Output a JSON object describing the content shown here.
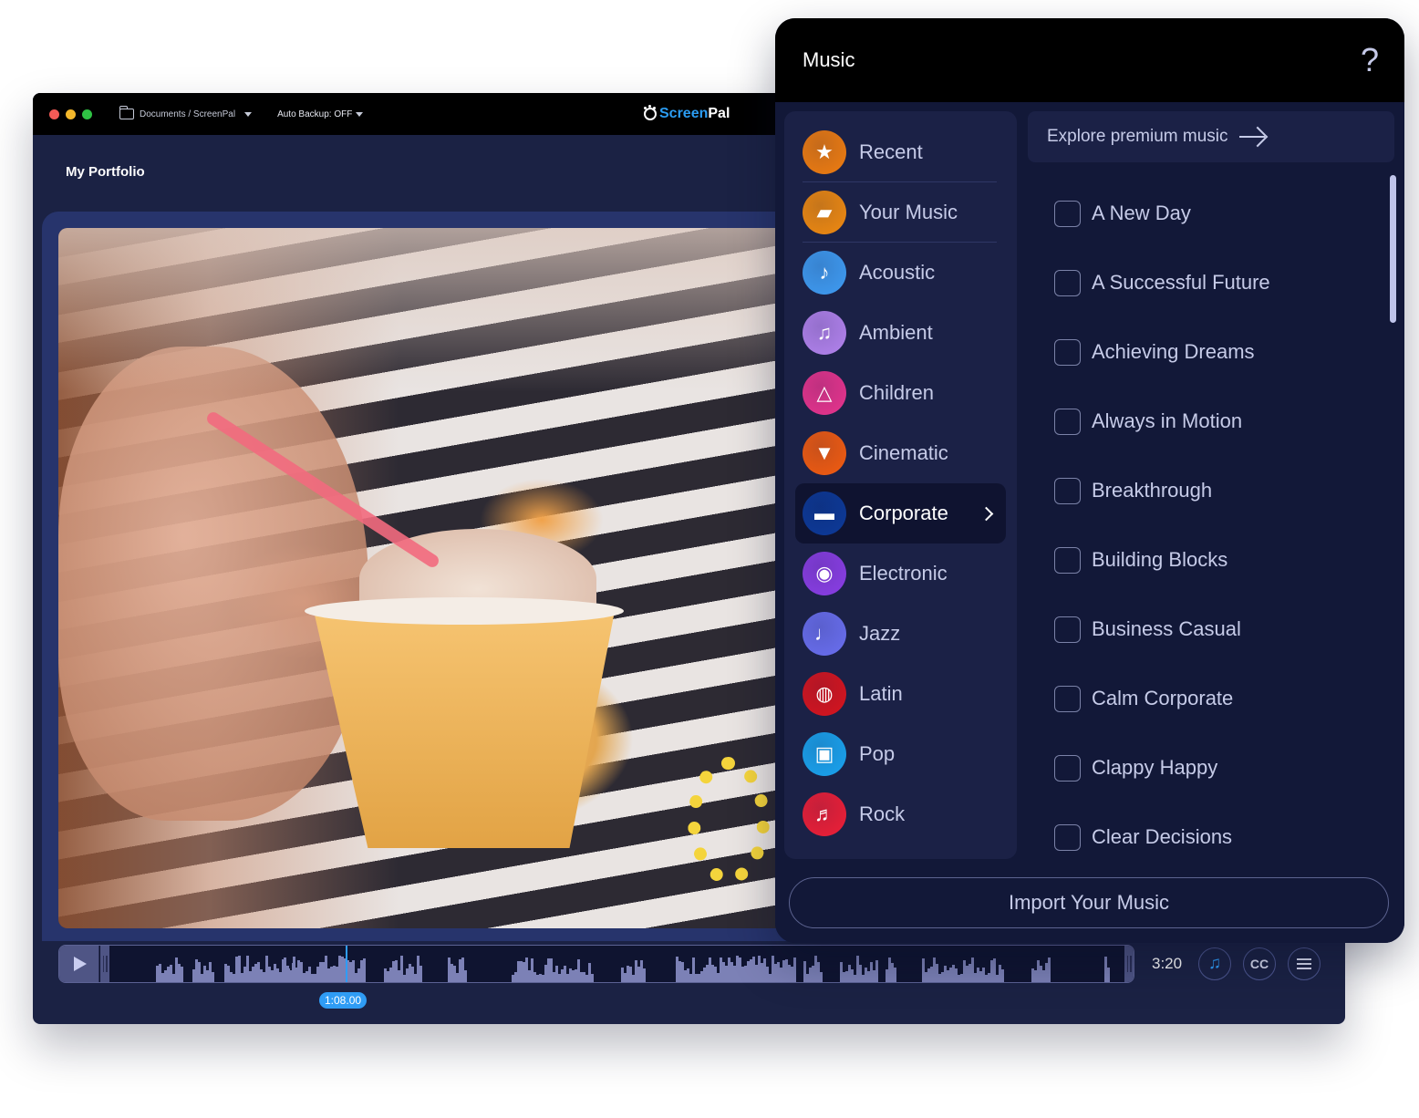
{
  "editor": {
    "breadcrumb": "Documents / ScreenPal",
    "auto_backup": "Auto Backup: OFF",
    "brand_part1": "Screen",
    "brand_part2": "Pal",
    "section_title": "My Portfolio",
    "timeline": {
      "playhead_time": "1:08.00",
      "playhead_fraction": 0.266,
      "duration": "3:20",
      "cc_label": "CC"
    }
  },
  "music_panel": {
    "title": "Music",
    "help_label": "?",
    "explore_label": "Explore premium music",
    "categories": [
      {
        "label": "Recent",
        "icon": "sparkle-star-icon",
        "color": "#f07d10",
        "glyph": "★"
      },
      {
        "label": "Your Music",
        "icon": "folder-bookmark-icon",
        "color": "#f08a10",
        "glyph": "▰"
      },
      {
        "label": "Acoustic",
        "icon": "acoustic-guitar-icon",
        "color": "#3f9cf3",
        "glyph": "♪"
      },
      {
        "label": "Ambient",
        "icon": "electric-guitar-icon",
        "color": "#b383ee",
        "glyph": "♫"
      },
      {
        "label": "Children",
        "icon": "metronome-icon",
        "color": "#e8348e",
        "glyph": "△"
      },
      {
        "label": "Cinematic",
        "icon": "popcorn-icon",
        "color": "#f35c10",
        "glyph": "▼"
      },
      {
        "label": "Corporate",
        "icon": "briefcase-icon",
        "color": "#0d3a9a",
        "glyph": "▬",
        "active": true
      },
      {
        "label": "Electronic",
        "icon": "turntable-icon",
        "color": "#8b3ee6",
        "glyph": "◉"
      },
      {
        "label": "Jazz",
        "icon": "saxophone-icon",
        "color": "#6a6ff0",
        "glyph": "♩"
      },
      {
        "label": "Latin",
        "icon": "drum-icon",
        "color": "#d8141e",
        "glyph": "◍"
      },
      {
        "label": "Pop",
        "icon": "radio-icon",
        "color": "#1aa4f0",
        "glyph": "▣"
      },
      {
        "label": "Rock",
        "icon": "rock-guitar-icon",
        "color": "#ef1f37",
        "glyph": "♬"
      }
    ],
    "tracks": [
      "A New Day",
      "A Successful Future",
      "Achieving Dreams",
      "Always in Motion",
      "Breakthrough",
      "Building Blocks",
      "Business Casual",
      "Calm Corporate",
      "Clappy Happy",
      "Clear Decisions"
    ],
    "import_label": "Import Your Music"
  },
  "colors": {
    "accent": "#2f9cf5",
    "panel_bg": "#0f1430",
    "editor_bg": "#1b2244"
  }
}
